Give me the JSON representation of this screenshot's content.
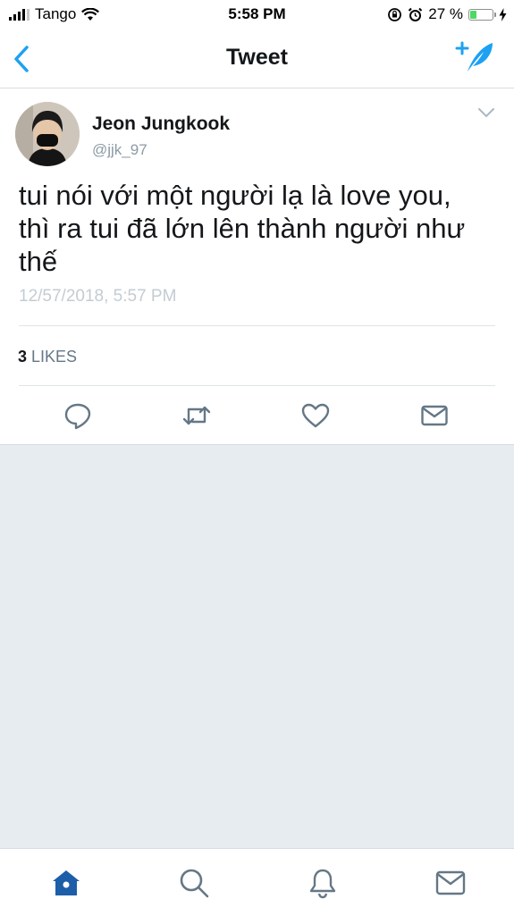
{
  "status_bar": {
    "carrier": "Tango",
    "time": "5:58 PM",
    "battery_percent": "27 %",
    "battery_level": 0.27
  },
  "nav": {
    "title": "Tweet",
    "back_icon": "chevron-left-icon",
    "compose_icon": "compose-tweet-icon"
  },
  "tweet": {
    "display_name": "Jeon Jungkook",
    "handle": "@jjk_97",
    "text": "tui nói với một người lạ là love you, thì ra tui đã lớn lên thành người như thế",
    "timestamp": "12/57/2018, 5:57 PM",
    "likes_count": "3",
    "likes_label": "LIKES",
    "actions": [
      "reply-icon",
      "retweet-icon",
      "like-icon",
      "direct-message-icon"
    ]
  },
  "tab_bar": {
    "items": [
      "home-icon",
      "search-icon",
      "notifications-icon",
      "messages-icon"
    ]
  },
  "colors": {
    "accent": "#1da1f2",
    "active_tab": "#1c5ea8",
    "icon_gray": "#657786",
    "background": "#e6ecf0"
  }
}
